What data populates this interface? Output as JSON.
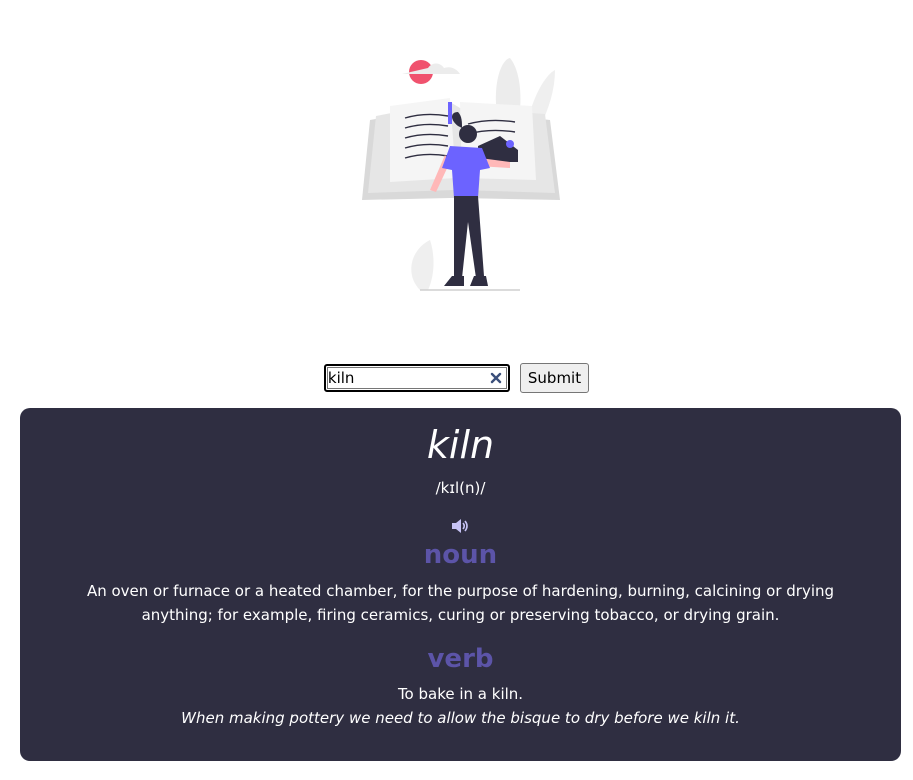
{
  "search": {
    "value": "kiln",
    "submit_label": "Submit"
  },
  "result": {
    "word": "kiln",
    "phonetic": "/kɪl(n)/",
    "meanings": [
      {
        "part_of_speech": "noun",
        "definition": "An oven or furnace or a heated chamber, for the purpose of hardening, burning, calcining or drying anything; for example, firing ceramics, curing or preserving tobacco, or drying grain."
      },
      {
        "part_of_speech": "verb",
        "definition": "To bake in a kiln.",
        "example": "When making pottery we need to allow the bisque to dry before we kiln it."
      }
    ]
  },
  "colors": {
    "card_bg": "#2f2e41",
    "accent": "#5c54a8",
    "illustration_accent": "#6c63ff",
    "sun": "#f0526e"
  },
  "icons": {
    "clear": "close-icon",
    "audio": "speaker-icon",
    "hero": "reading-woman-illustration"
  }
}
